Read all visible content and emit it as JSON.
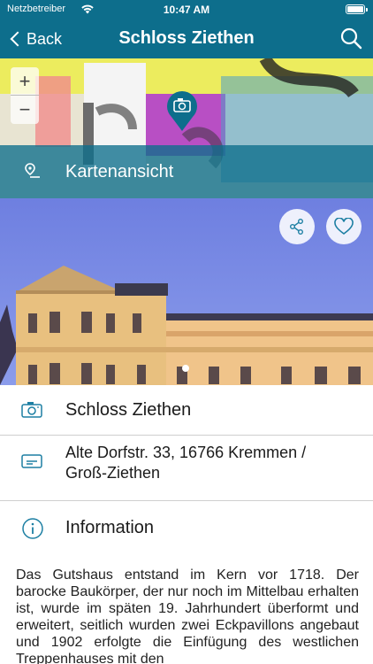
{
  "status_bar": {
    "carrier": "Netzbetreiber",
    "time": "10:47 AM"
  },
  "nav": {
    "back_label": "Back",
    "title": "Schloss Ziethen"
  },
  "map": {
    "zoom_in": "+",
    "zoom_out": "−",
    "footer_label": "Kartenansicht"
  },
  "photo": {
    "page_count": 1
  },
  "details": {
    "name": "Schloss Ziethen",
    "address": "Alte Dorfstr. 33, 16766 Kremmen / Groß-Ziethen",
    "info_heading": "Information"
  },
  "description": "Das Gutshaus entstand im Kern vor 1718. Der barocke Baukörper, der nur noch im Mittelbau erhalten ist, wurde im späten 19. Jahrhundert überformt und erweitert, seitlich wurden zwei Eckpavillons angebaut und 1902 erfolgte die Einfügung des westlichen Treppenhauses mit den",
  "colors": {
    "accent": "#0d6e8c",
    "icon": "#1d7fa3"
  }
}
